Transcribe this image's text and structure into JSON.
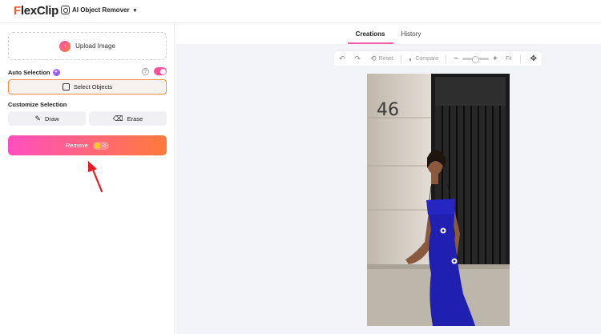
{
  "header": {
    "logo_text_first": "F",
    "logo_text_rest": "lexClip",
    "tool_name": "AI Object Remover"
  },
  "left_panel": {
    "upload_label": "Upload Image",
    "auto_selection_label": "Auto Selection",
    "auto_selection_enabled": true,
    "select_objects_label": "Select Objects",
    "customize_label": "Customize Selection",
    "draw_label": "Draw",
    "erase_label": "Erase",
    "remove_label": "Remove",
    "remove_cost": "-3"
  },
  "work_area": {
    "tabs": [
      {
        "label": "Creations",
        "active": true
      },
      {
        "label": "History",
        "active": false
      }
    ],
    "toolbar": {
      "reset_label": "Reset",
      "compare_label": "Compare",
      "fit_label": "Fit"
    },
    "image": {
      "door_number": "46"
    }
  },
  "colors": {
    "accent_pink": "#ff4fb0",
    "accent_orange": "#ff7b3a",
    "dress_blue": "#1f1fb0"
  }
}
